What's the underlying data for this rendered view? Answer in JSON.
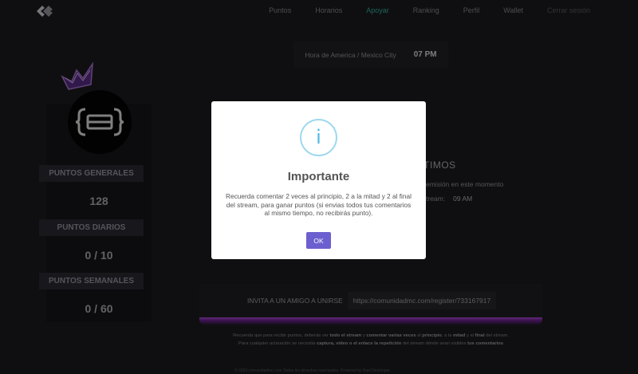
{
  "nav": {
    "items": [
      {
        "label": "Puntos"
      },
      {
        "label": "Horarios"
      },
      {
        "label": "Apoyar"
      },
      {
        "label": "Ranking"
      },
      {
        "label": "Perfil"
      },
      {
        "label": "Wallet"
      },
      {
        "label": "Cerrar sesión"
      }
    ],
    "active_item": "Apoyar"
  },
  "timebox": {
    "label": "Hora de America / Mexico City",
    "time": "07 PM"
  },
  "profile": {
    "stats": [
      {
        "label": "PUNTOS GENERALES",
        "value": "128"
      },
      {
        "label": "PUNTOS DIARIOS",
        "value": "0 / 10"
      },
      {
        "label": "PUNTOS SEMANALES",
        "value": "0 / 60"
      }
    ]
  },
  "background": {
    "heading": "NTIMOS",
    "line1": "emisión en este momento",
    "line2_label": "tream:",
    "line2_value": "09 AM"
  },
  "invite": {
    "label": "INVITA A UN AMIGO A UNIRSE",
    "link": "https://comunidadmc.com/register/733167917"
  },
  "footer": {
    "line1_a": "Recuerda que para recibir puntos, deberás ver ",
    "line1_b": "todo el stream",
    "line1_c": " y ",
    "line1_d": "comentar varias veces",
    "line1_e": " al ",
    "line1_f": "principio",
    "line1_g": ", a la ",
    "line1_h": "mitad",
    "line1_i": " y al ",
    "line1_j": "final",
    "line1_k": " del stream.",
    "line2_a": "Para cualquier aclaración se necesita ",
    "line2_b": "captura, video o el enlace la repetición",
    "line2_c": " del stream dónde sean visibles ",
    "line2_d": "tus comentarios",
    "copyright": "© 2023 comunidadmc.com Todos los derechos reservados. Powered by Dael Developer"
  },
  "modal": {
    "icon": "i",
    "title": "Importante",
    "text": "Recuerda comentar 2 veces al principio, 2 a la mitad y 2 al final del stream, para ganar puntos (si envias todos tus comentarios al mismo tiempo, no recibirás punto).",
    "ok_label": "OK"
  },
  "colors": {
    "accent_nav": "#35b4a2",
    "ok_button": "#6c5fcf",
    "info_icon": "#4fb8e4",
    "glow": "#b04ad8"
  }
}
